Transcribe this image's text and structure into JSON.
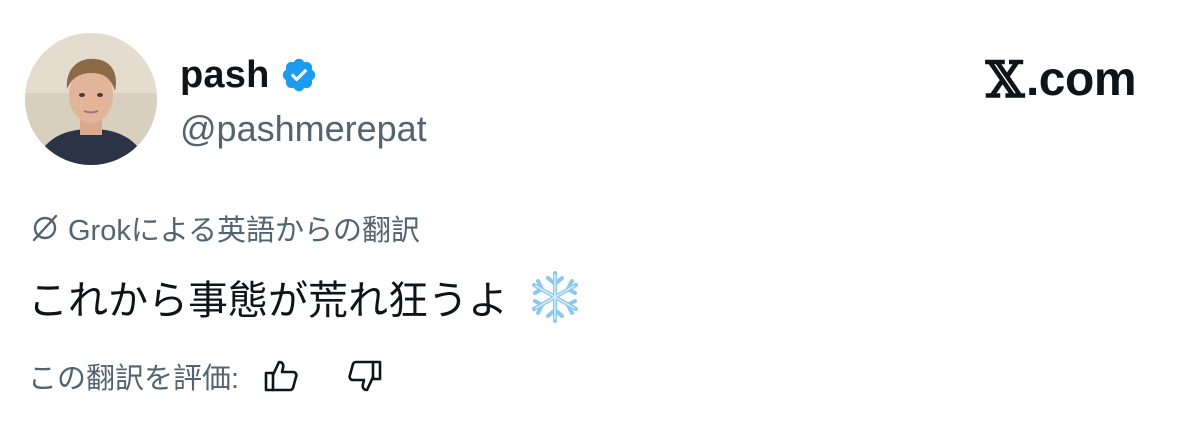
{
  "author": {
    "display_name": "pash",
    "handle": "@pashmerepat",
    "verified_icon": "verified-badge-icon",
    "verified_color": "#1d9bf0"
  },
  "brand": {
    "label": ".com",
    "logo_icon": "x-logo-icon"
  },
  "translation": {
    "label": "Grokによる英語からの翻訳",
    "icon": "grok-icon"
  },
  "tweet": {
    "text": "これから事態が荒れ狂うよ",
    "emoji_icon": "snowflake-icon"
  },
  "rating": {
    "label": "この翻訳を評価:",
    "up_icon": "thumbs-up-icon",
    "down_icon": "thumbs-down-icon"
  },
  "colors": {
    "text": "#0f1419",
    "secondary": "#536471",
    "verified": "#1d9bf0"
  }
}
